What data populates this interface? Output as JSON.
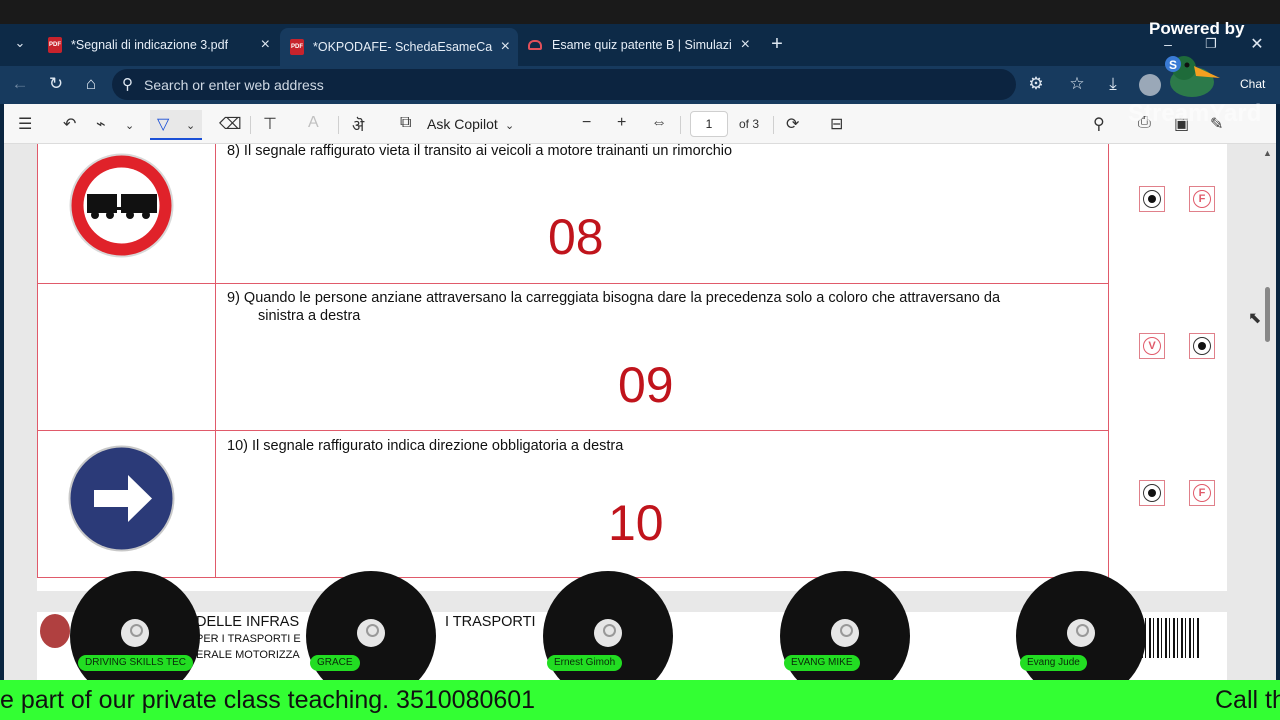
{
  "browser": {
    "tabs": [
      {
        "label": "*Segnali di indicazione 3.pdf",
        "icon": "pdf-icon"
      },
      {
        "label": "*OKPODAFE- SchedaEsameCandid",
        "icon": "pdf-icon"
      },
      {
        "label": "Esame quiz patente B | Simulazion",
        "icon": "car-icon"
      }
    ],
    "address_placeholder": "Search or enter web address",
    "chat_label": "Chat"
  },
  "pdf_toolbar": {
    "ask_copilot": "Ask Copilot",
    "page_number": "1",
    "page_total": "of 3"
  },
  "questions": [
    {
      "text": "8)  Il segnale raffigurato vieta il transito ai veicoli a motore trainanti un rimorchio",
      "number": "08",
      "answers": [
        "X",
        "F"
      ],
      "sign": "no-trailer-sign"
    },
    {
      "text": "9)  Quando le persone anziane attraversano la carreggiata bisogna dare la precedenza solo a coloro che attraversano da",
      "text2": "sinistra a destra",
      "number": "09",
      "answers": [
        "V",
        "X"
      ],
      "sign": ""
    },
    {
      "text": "10)  Il segnale raffigurato indica direzione obbligatoria a destra",
      "number": "10",
      "answers": [
        "X",
        "F"
      ],
      "sign": "mandatory-right-sign"
    }
  ],
  "footer_page": {
    "line1": "DELLE INFRAS",
    "line1b": "I TRASPORTI",
    "line2": "PER I TRASPORTI E",
    "line3": "ERALE MOTORIZZA"
  },
  "overlay": {
    "powered_by": "Powered by",
    "watermark": "StreamYard",
    "participants": [
      "DRIVING SKILLS TEC",
      "GRACE",
      "Ernest Gimoh",
      "EVANG MIKE",
      "Evang Jude"
    ],
    "ticker_main": "e part of our private class teaching. 3510080601",
    "ticker_tail": "Call th"
  },
  "colors": {
    "question_number": "#c0141c",
    "table_line": "#e05a6a",
    "ticker_bg": "#33ff33",
    "name_badge": "#22dd22"
  }
}
